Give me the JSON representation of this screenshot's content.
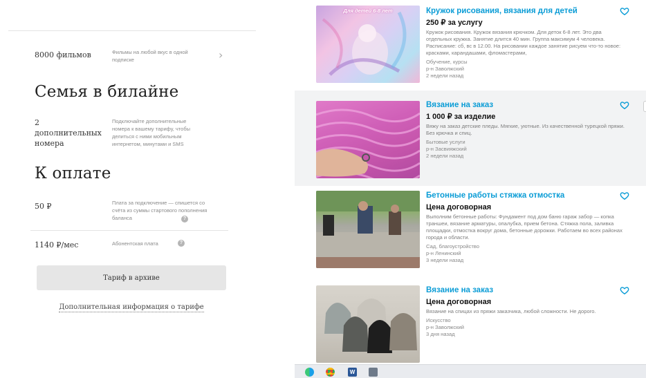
{
  "left": {
    "films_row": {
      "label": "8000 фильмов",
      "desc": "Фильмы на любой вкус в одной подписке"
    },
    "family": {
      "title": "Семья в билайне",
      "label": "2 дополнительных номера",
      "desc": "Подключайте дополнительные номера к вашему тарифу, чтобы делиться с ними мобильным интернетом, минутами и SMS"
    },
    "payment": {
      "title": "К оплате",
      "rows": [
        {
          "value": "50 ₽",
          "desc": "Плата за подключение — спишется со счёта из суммы стартового пополнения баланса"
        },
        {
          "value": "1140 ₽/мес",
          "desc": "Абонентская плата"
        }
      ]
    },
    "archive_button": "Тариф в архиве",
    "more_info_link": "Дополнительная информация о тарифе"
  },
  "listings": [
    {
      "title": "Кружок рисования, вязания для детей",
      "price": "250 ₽ за услугу",
      "description": "Кружок рисования. Кружок вязания крючком. Для деток 6-8 лет. Это два отдельных кружка. Занятие длится 40 мин. Группа максимум 4 человека. Расписание: сб, вс в 12.00. На рисовании каждое занятие рисуем что-то новое: красками, карандашами, фломастерами,",
      "category": "Обучение, курсы",
      "district": "р-н Заволжский",
      "posted": "2 недели назад",
      "image_tag": "Для детей 6-8 лет"
    },
    {
      "title": "Вязание на заказ",
      "price": "1 000 ₽ за изделие",
      "description": "Вяжу на заказ детские пледы. Мягкие, уютные. Из качественной турецкой пряжи. Без крючка и спиц.",
      "category": "Бытовые услуги",
      "district": "р-н Засвияжский",
      "posted": "2 недели назад"
    },
    {
      "title": "Бетонные работы стяжка отмостка",
      "price": "Цена договорная",
      "description": "Выполним бетонные работы: Фундамент под дом баню гараж забор — копка траншеи, вязание арматуры, опалубка, прием бетона. Стяжка пола, заливка площадки, отмостка вокруг дома, бетонные дорожки. Работаем во всех районах города и области.",
      "category": "Сад, благоустройство",
      "district": "р-н Ленинский",
      "posted": "3 недели назад"
    },
    {
      "title": "Вязание на заказ",
      "price": "Цена договорная",
      "description": "Вязание на спицах из пряжи заказчика, любой сложности. Не дорого.",
      "category": "Искусство",
      "district": "р-н Заволжский",
      "posted": "3 дня назад"
    }
  ],
  "taskbar": {
    "icons": [
      "edge-icon",
      "chrome-icon",
      "word-icon",
      "calculator-icon"
    ]
  },
  "colors": {
    "link_blue": "#0a9cd6",
    "highlight_bg": "#f2f3f4",
    "button_gray": "#e6e6e6"
  }
}
